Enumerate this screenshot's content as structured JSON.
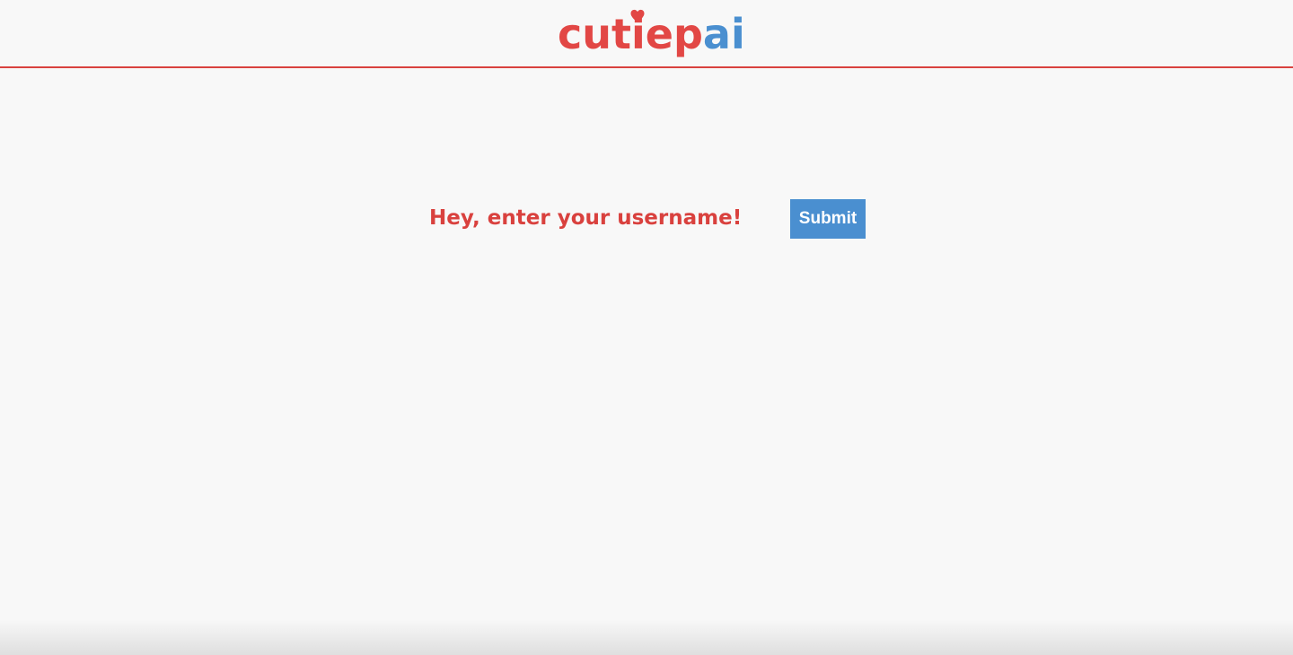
{
  "header": {
    "logo": {
      "part1": "cutiep",
      "part2": "ai",
      "color_primary": "#e24745",
      "color_secondary": "#4a8fd0",
      "heart_icon": "heart-icon"
    },
    "border_color": "#d9413e"
  },
  "form": {
    "prompt": "Hey, enter your username!",
    "username_value": "",
    "submit_label": "Submit",
    "submit_color": "#4a8fd0"
  }
}
